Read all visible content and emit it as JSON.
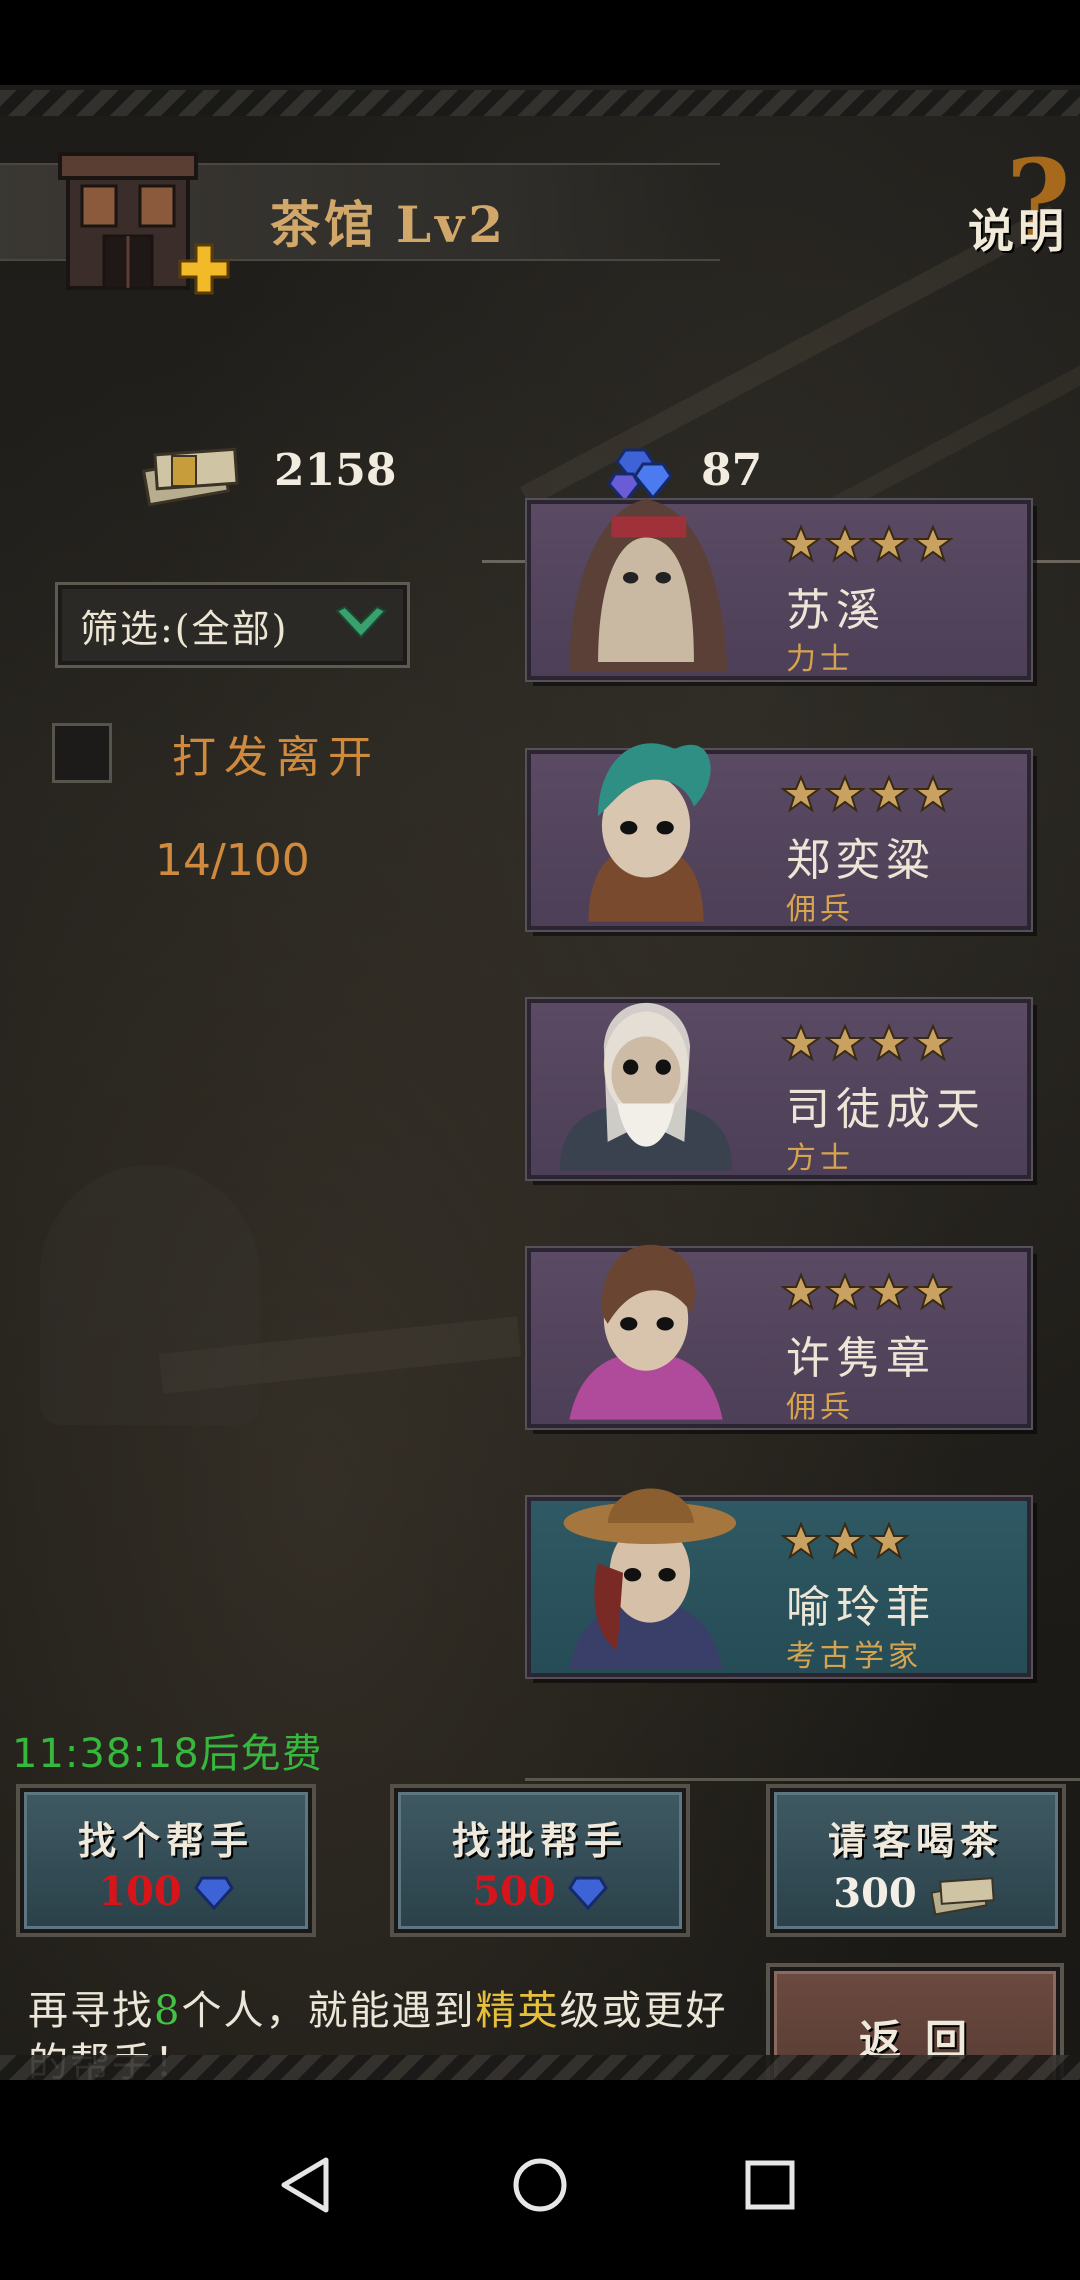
{
  "header": {
    "title": "茶馆",
    "level": "Lv2",
    "help_label": "说明",
    "help_mark": "?"
  },
  "currency": {
    "money": "2158",
    "gems": "87"
  },
  "filter": {
    "label": "筛选:(全部)"
  },
  "dismiss": {
    "label": "打发离开",
    "checked": false
  },
  "roster_count": "14/100",
  "heroes": [
    {
      "name": "苏溪",
      "class": "力士",
      "stars": 4,
      "card_color": "purple",
      "portrait_icon": "hooded-man-portrait"
    },
    {
      "name": "郑奕粱",
      "class": "佣兵",
      "stars": 4,
      "card_color": "purple",
      "portrait_icon": "green-haired-girl-portrait"
    },
    {
      "name": "司徒成天",
      "class": "方士",
      "stars": 4,
      "card_color": "purple",
      "portrait_icon": "old-bearded-man-portrait"
    },
    {
      "name": "许隽章",
      "class": "佣兵",
      "stars": 4,
      "card_color": "purple",
      "portrait_icon": "ponytail-woman-portrait"
    },
    {
      "name": "喻玲菲",
      "class": "考古学家",
      "stars": 3,
      "card_color": "teal",
      "portrait_icon": "hat-woman-portrait"
    }
  ],
  "timer": "11:38:18后免费",
  "actions": [
    {
      "label": "找个帮手",
      "cost": "100",
      "currency_icon": "gem-icon",
      "cost_color": "red"
    },
    {
      "label": "找批帮手",
      "cost": "500",
      "currency_icon": "gem-icon",
      "cost_color": "red"
    },
    {
      "label": "请客喝茶",
      "cost": "300",
      "currency_icon": "money-icon",
      "cost_color": "white"
    }
  ],
  "back_label": "返回",
  "hint": {
    "part1": "再寻找",
    "num": "8",
    "part2": "个人，就能遇到",
    "tier": "精英",
    "part3": "级或更好的帮手！"
  },
  "colors": {
    "accent_gold": "#d2a86a",
    "orange_text": "#d08a3d",
    "timer_green": "#36b83c",
    "cost_red": "#d8141b",
    "card_purple": "#5a4a63",
    "card_teal": "#2f5964"
  }
}
